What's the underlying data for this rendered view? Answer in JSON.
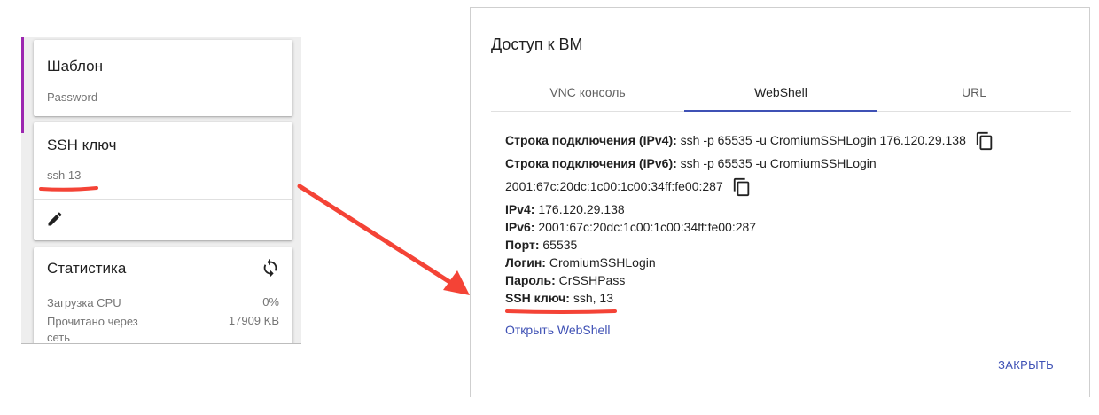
{
  "left_panel": {
    "template_card": {
      "title": "Шаблон",
      "subtitle": "Password"
    },
    "ssh_card": {
      "title": "SSH ключ",
      "value": "ssh 13",
      "edit_icon": "pencil-icon"
    },
    "stats_card": {
      "title": "Статистика",
      "refresh_icon": "refresh-icon",
      "rows": [
        {
          "label": "Загрузка CPU",
          "value": "0%"
        },
        {
          "label": "Прочитано через сеть",
          "value": "17909 KB"
        }
      ]
    }
  },
  "dialog": {
    "title": "Доступ к ВМ",
    "tabs": [
      {
        "label": "VNC консоль",
        "active": false
      },
      {
        "label": "WebShell",
        "active": true
      },
      {
        "label": "URL",
        "active": false
      }
    ],
    "fields": {
      "conn_ipv4_label": "Строка подключения (IPv4):",
      "conn_ipv4_value": "ssh -p 65535 -u CromiumSSHLogin 176.120.29.138",
      "conn_ipv6_label": "Строка подключения (IPv6):",
      "conn_ipv6_value": "ssh -p 65535 -u CromiumSSHLogin",
      "conn_ipv6_value_cont": "2001:67c:20dc:1c00:1c00:34ff:fe00:287",
      "ipv4_label": "IPv4:",
      "ipv4_value": "176.120.29.138",
      "ipv6_label": "IPv6:",
      "ipv6_value": "2001:67c:20dc:1c00:1c00:34ff:fe00:287",
      "port_label": "Порт:",
      "port_value": "65535",
      "login_label": "Логин:",
      "login_value": "CromiumSSHLogin",
      "password_label": "Пароль:",
      "password_value": "CrSSHPass",
      "ssh_key_label": "SSH ключ:",
      "ssh_key_value": "ssh, 13"
    },
    "copy_icon": "copy-icon",
    "open_webshell_link": "Открыть WebShell",
    "close_button": "ЗАКРЫТЬ"
  },
  "colors": {
    "accent": "#3f51b5",
    "annotation": "#f44336",
    "sidebar_accent": "#9c27b0"
  }
}
